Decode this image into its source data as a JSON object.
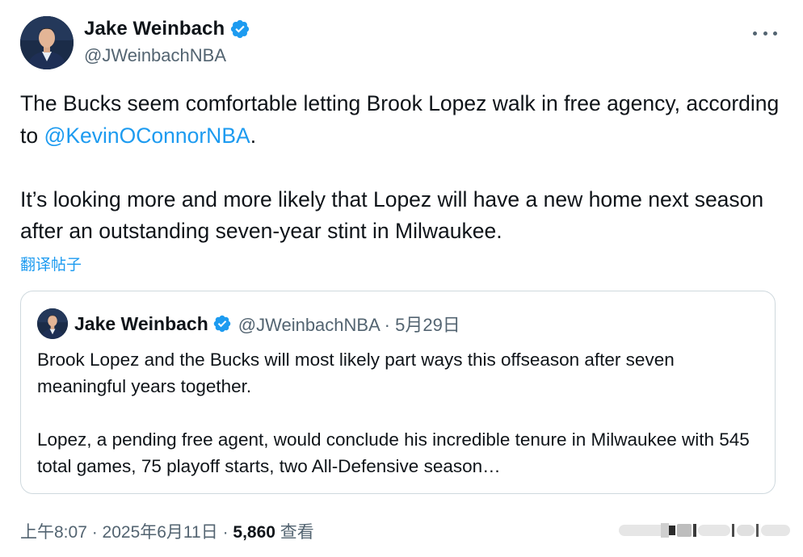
{
  "author": {
    "display_name": "Jake Weinbach",
    "handle": "@JWeinbachNBA"
  },
  "tweet": {
    "text_part1": "The Bucks seem comfortable letting Brook Lopez walk in free agency, according to ",
    "mention": "@KevinOConnorNBA",
    "text_part1_end": ".",
    "text_part2": "It’s looking more and more likely that Lopez will have a new home next season after an outstanding seven-year stint in Milwaukee.",
    "translate_label": "翻译帖子"
  },
  "quoted_tweet": {
    "display_name": "Jake Weinbach",
    "handle_date": "@JWeinbachNBA · 5月29日",
    "para1": "Brook Lopez and the Bucks will most likely part ways this offseason after seven meaningful years together.",
    "para2": "Lopez, a pending free agent, would conclude his incredible tenure in Milwaukee with 545 total games, 75 playoff starts, two All-Defensive season…"
  },
  "footer": {
    "timestamp": "上午8:07 · 2025年6月11日 · ",
    "views_count": "5,860",
    "views_label": " 查看"
  },
  "icons": {
    "verified": "verified-badge-icon",
    "more": "more-options-icon"
  },
  "colors": {
    "accent": "#1d9bf0",
    "text": "#0f1419",
    "secondary": "#536471",
    "border": "#cfd9de"
  }
}
